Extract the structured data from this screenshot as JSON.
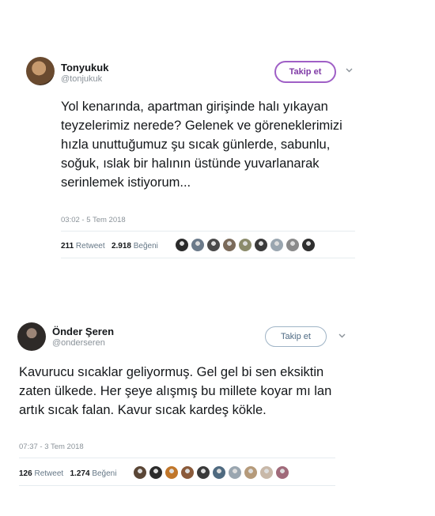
{
  "tweets": [
    {
      "name": "Tonyukuk",
      "handle": "@tonjukuk",
      "follow_label": "Takip et",
      "text": "Yol kenarında, apartman girişinde halı yıkayan teyzelerimiz nerede? Gelenek ve göreneklerimizi hızla unuttuğumuz şu sıcak günlerde, sabunlu, soğuk, ıslak bir halının üstünde yuvarlanarak serinlemek istiyorum...",
      "timestamp": "03:02 - 5 Tem 2018",
      "retweet_count": "211",
      "retweet_label": "Retweet",
      "like_count": "2.918",
      "like_label": "Beğeni",
      "liker_colors": [
        "#2b2b2b",
        "#6b7a8a",
        "#4a4a4a",
        "#7a6a5a",
        "#8b8b6b",
        "#3a3a3a",
        "#9aa6b0",
        "#8a8a8a",
        "#2f2f2f"
      ]
    },
    {
      "name": "Önder Şeren",
      "handle": "@onderseren",
      "follow_label": "Takip et",
      "text": "Kavurucu sıcaklar geliyormuş. Gel gel bi sen eksiktin zaten ülkede. Her şeye alışmış bu millete koyar mı lan artık sıcak falan. Kavur sıcak kardeş kökle.",
      "timestamp": "07:37 - 3 Tem 2018",
      "retweet_count": "126",
      "retweet_label": "Retweet",
      "like_count": "1.274",
      "like_label": "Beğeni",
      "liker_colors": [
        "#5a4636",
        "#2b2b2b",
        "#c0762a",
        "#8a5a3a",
        "#3a3a3a",
        "#4f6a80",
        "#9aa6b0",
        "#b59a7a",
        "#c8b8a8",
        "#a06a7a"
      ]
    }
  ]
}
